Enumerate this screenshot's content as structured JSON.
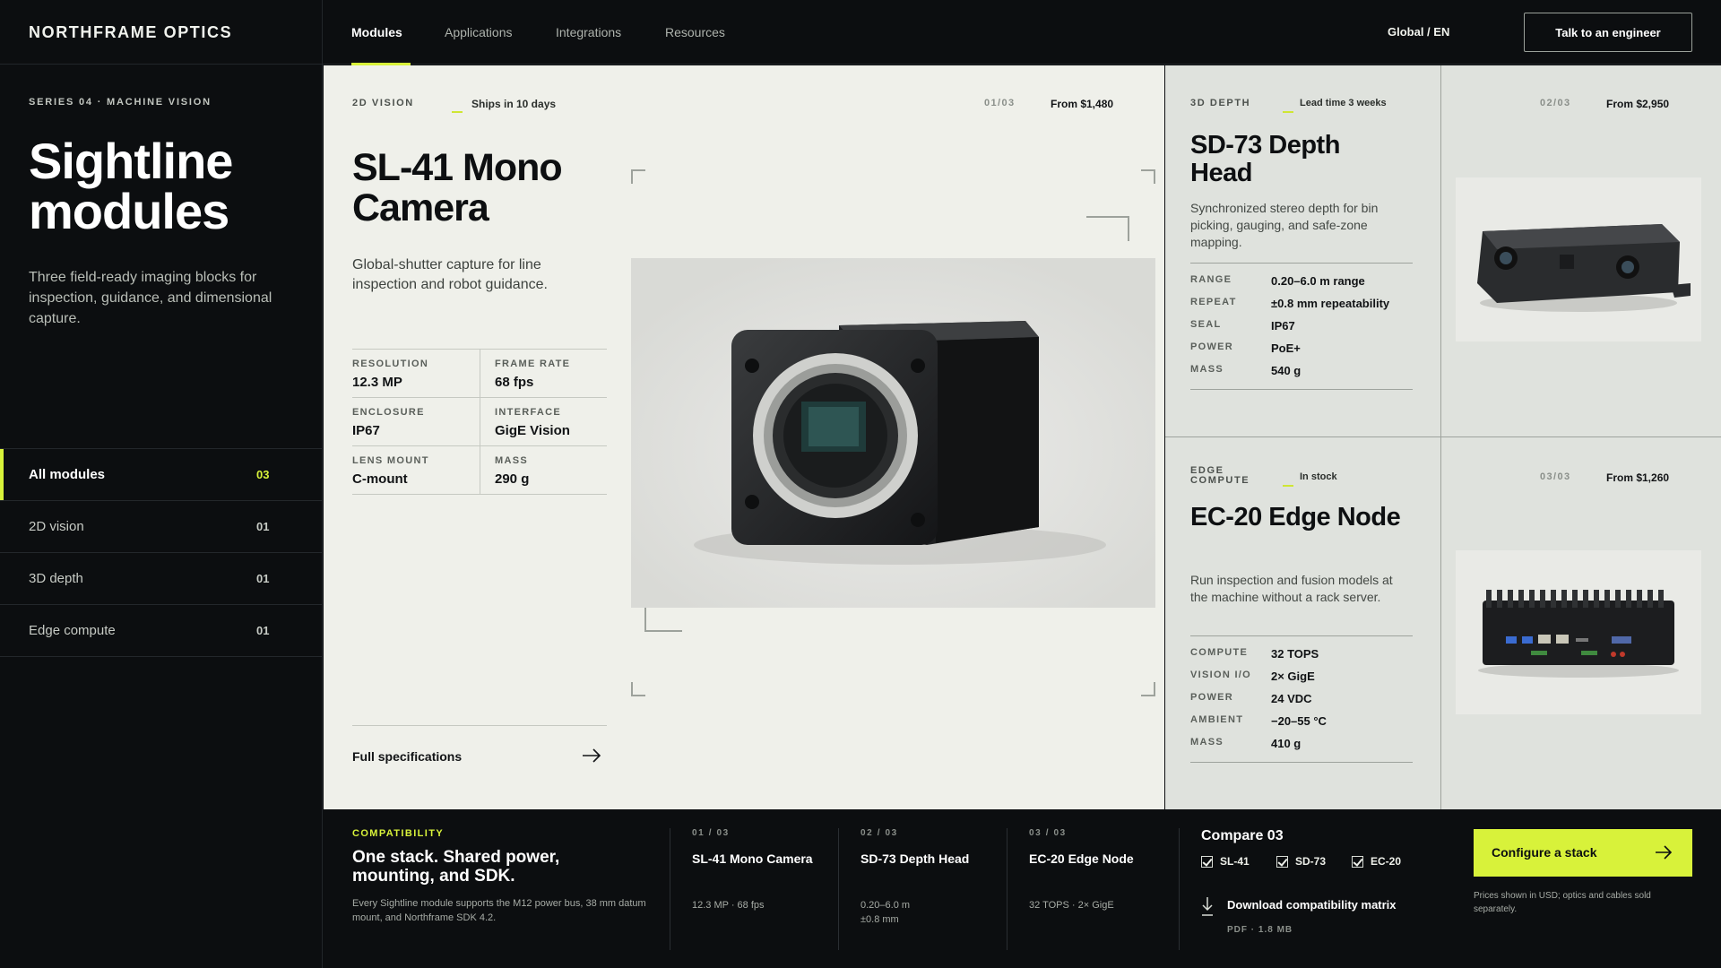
{
  "brand": "NORTHFRAME OPTICS",
  "nav": {
    "items": [
      {
        "label": "Modules",
        "active": true
      },
      {
        "label": "Applications"
      },
      {
        "label": "Integrations"
      },
      {
        "label": "Resources"
      }
    ],
    "locale": "Global / EN",
    "cta": "Talk to an engineer"
  },
  "sidebar": {
    "eyebrow": "SERIES 04 · MACHINE VISION",
    "title": "Sightline modules",
    "description": "Three field-ready imaging blocks for inspection, guidance, and dimensional capture.",
    "filters": [
      {
        "label": "All modules",
        "count": "03",
        "active": true
      },
      {
        "label": "2D vision",
        "count": "01"
      },
      {
        "label": "3D depth",
        "count": "01"
      },
      {
        "label": "Edge compute",
        "count": "01"
      }
    ]
  },
  "main": {
    "category": "2D VISION",
    "availability": "Ships in 10 days",
    "pager": "01/03",
    "price": "From $1,480",
    "title": "SL-41 Mono Camera",
    "description": "Global-shutter capture for line inspection and robot guidance.",
    "specs": [
      {
        "key": "RESOLUTION",
        "value": "12.3 MP"
      },
      {
        "key": "FRAME RATE",
        "value": "68 fps"
      },
      {
        "key": "ENCLOSURE",
        "value": "IP67"
      },
      {
        "key": "INTERFACE",
        "value": "GigE Vision"
      },
      {
        "key": "LENS MOUNT",
        "value": "C-mount"
      },
      {
        "key": "MASS",
        "value": "290 g"
      }
    ],
    "link": "Full specifications"
  },
  "cards": [
    {
      "category": "3D DEPTH",
      "availability": "Lead time 3 weeks",
      "pager": "02/03",
      "price": "From $2,950",
      "title": "SD-73 Depth Head",
      "description": "Synchronized stereo depth for bin picking, gauging, and safe-zone mapping.",
      "specs": [
        {
          "key": "RANGE",
          "value": "0.20–6.0 m range"
        },
        {
          "key": "REPEAT",
          "value": "±0.8 mm repeatability"
        },
        {
          "key": "SEAL",
          "value": "IP67"
        },
        {
          "key": "POWER",
          "value": "PoE+"
        },
        {
          "key": "MASS",
          "value": "540 g"
        }
      ]
    },
    {
      "category": "EDGE COMPUTE",
      "availability": "In stock",
      "pager": "03/03",
      "price": "From $1,260",
      "title": "EC-20 Edge Node",
      "description": "Run inspection and fusion models at the machine without a rack server.",
      "specs": [
        {
          "key": "COMPUTE",
          "value": "32 TOPS"
        },
        {
          "key": "VISION I/O",
          "value": "2× GigE"
        },
        {
          "key": "POWER",
          "value": "24 VDC"
        },
        {
          "key": "AMBIENT",
          "value": "−20–55 °C"
        },
        {
          "key": "MASS",
          "value": "410 g"
        }
      ]
    }
  ],
  "strip": {
    "eyebrow": "COMPATIBILITY",
    "title": "One stack. Shared power, mounting, and SDK.",
    "description": "Every Sightline module supports the M12 power bus, 38 mm datum mount, and Northframe SDK 4.2.",
    "modules": [
      {
        "index": "01 / 03",
        "name": "SL-41 Mono Camera",
        "spec": "12.3 MP · 68 fps"
      },
      {
        "index": "02 / 03",
        "name": "SD-73 Depth Head",
        "spec": "0.20–6.0 m ±0.8 mm"
      },
      {
        "index": "03 / 03",
        "name": "EC-20 Edge Node",
        "spec": "32 TOPS · 2× GigE"
      }
    ],
    "compare": {
      "title": "Compare 03",
      "items": [
        {
          "label": "SL-41",
          "checked": true
        },
        {
          "label": "SD-73",
          "checked": true
        },
        {
          "label": "EC-20",
          "checked": true
        }
      ],
      "download_label": "Download compatibility matrix",
      "download_meta": "PDF · 1.8 MB"
    },
    "configure_button": "Configure a stack",
    "note": "Prices shown in USD; optics and cables sold separately."
  },
  "colors": {
    "accent": "#d8f23a",
    "background": "#0c0e10",
    "card_main": "#eff0ea",
    "card_side": "#dfe2dd"
  },
  "icons": [
    "arrow-right-icon",
    "download-icon",
    "checkbox-checked-icon"
  ]
}
